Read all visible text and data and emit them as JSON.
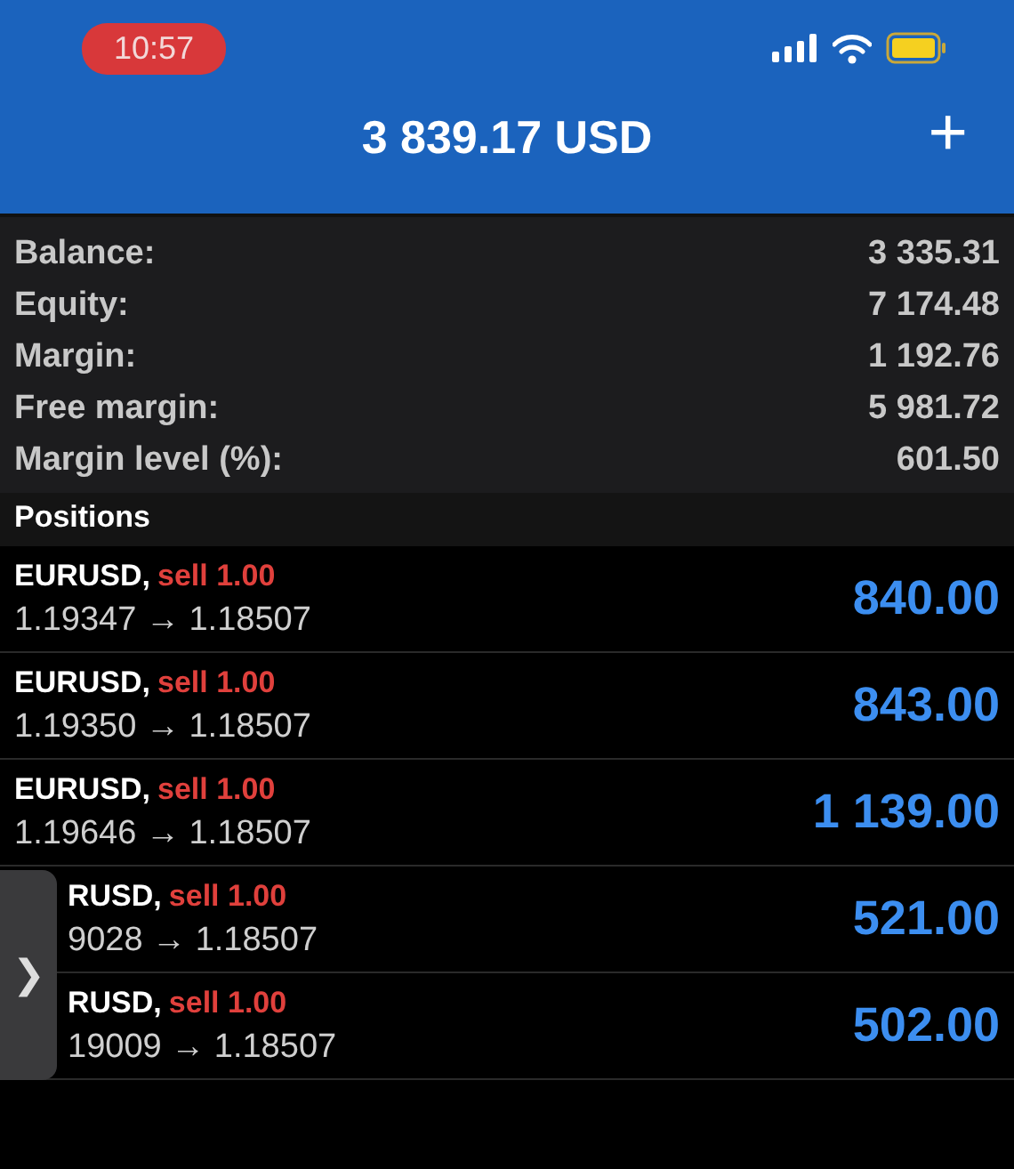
{
  "status_bar": {
    "time": "10:57"
  },
  "header": {
    "title": "3 839.17 USD",
    "action": "+"
  },
  "summary": [
    {
      "label": "Balance:",
      "value": "3 335.31"
    },
    {
      "label": "Equity:",
      "value": "7 174.48"
    },
    {
      "label": "Margin:",
      "value": "1 192.76"
    },
    {
      "label": "Free margin:",
      "value": "5 981.72"
    },
    {
      "label": "Margin level (%):",
      "value": "601.50"
    }
  ],
  "positions_header": "Positions",
  "positions": [
    {
      "kind": "full",
      "symbol": "EURUSD,",
      "order": "sell 1.00",
      "prices": "1.19347 → 1.18507",
      "profit": "840.00"
    },
    {
      "kind": "full",
      "symbol": "EURUSD,",
      "order": "sell 1.00",
      "prices": "1.19350 → 1.18507",
      "profit": "843.00"
    },
    {
      "kind": "full",
      "symbol": "EURUSD,",
      "order": "sell 1.00",
      "prices": "1.19646 → 1.18507",
      "profit": "1 139.00"
    },
    {
      "kind": "partial",
      "symbol": "RUSD,",
      "order": "sell 1.00",
      "prices": "9028 → 1.18507",
      "profit": "521.00"
    },
    {
      "kind": "partial",
      "symbol": "RUSD,",
      "order": "sell 1.00",
      "prices": "19009 → 1.18507",
      "profit": "502.00"
    }
  ],
  "side_handle": {
    "glyph": "❯"
  }
}
